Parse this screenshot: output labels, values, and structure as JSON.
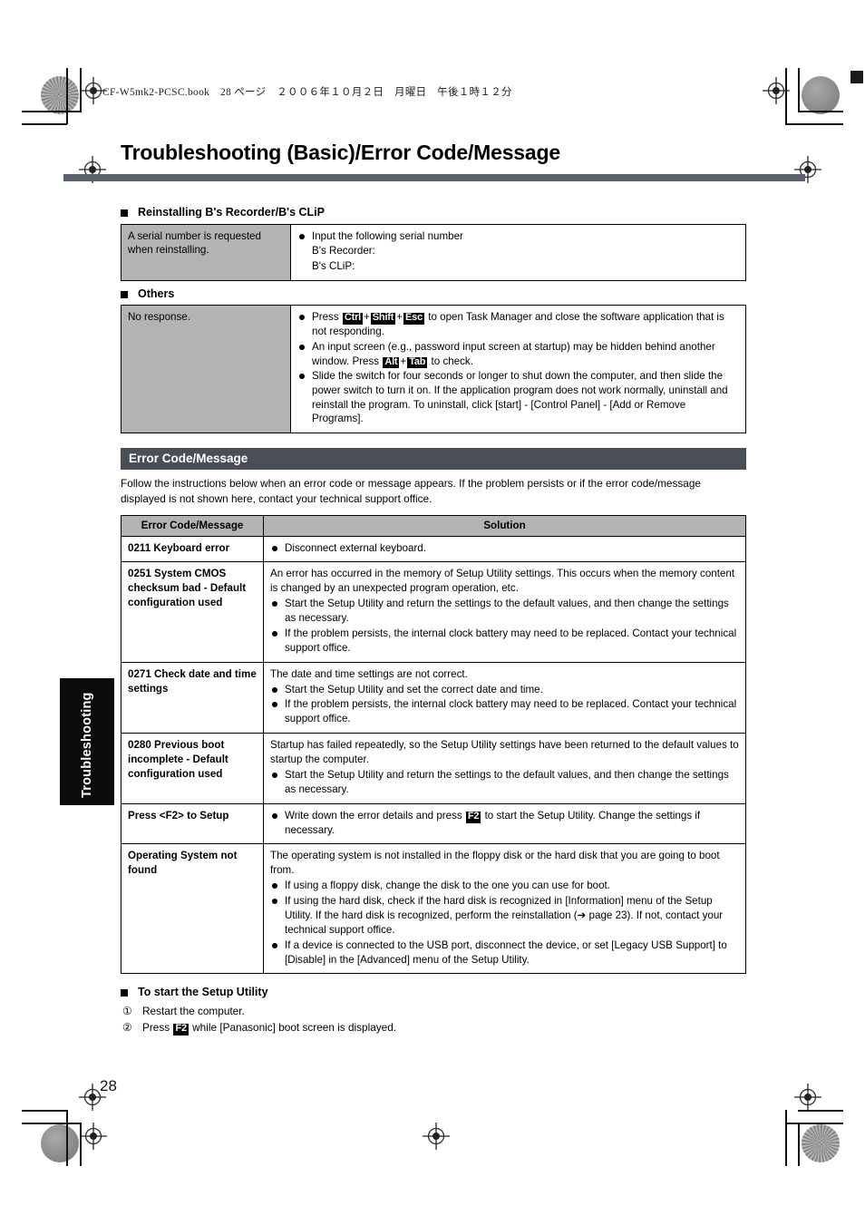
{
  "book_header": "CF-W5mk2-PCSC.book　28 ページ　２００６年１０月２日　月曜日　午後１時１２分",
  "page_title": "Troubleshooting (Basic)/Error Code/Message",
  "side_tab": "Troubleshooting",
  "folio": "28",
  "sections": {
    "reinstall": {
      "heading": "Reinstalling B's Recorder/B's CLiP",
      "row": {
        "key": "A serial number is requested when reinstalling.",
        "bullets": [
          "Input the following serial number"
        ],
        "plain_lines": [
          "B's Recorder:",
          "B's CLiP:"
        ]
      }
    },
    "others": {
      "heading": "Others",
      "row": {
        "key": "No response.",
        "bullets": [
          "Press {Ctrl}+{Shift}+{Esc} to open Task Manager and close the software application that is not responding.",
          "An input screen (e.g., password input screen at startup) may be hidden behind another window. Press {Alt}+{Tab} to check.",
          "Slide the switch for four seconds or longer to shut down the computer, and then slide the power switch to turn it on. If the application program does not work normally, uninstall and reinstall the program. To uninstall, click [start] - [Control Panel] - [Add or Remove Programs]."
        ]
      }
    }
  },
  "error_section": {
    "bar_title": "Error Code/Message",
    "intro": "Follow the instructions below when an error code or message appears. If the problem persists or if the error code/message displayed is not shown here, contact your technical support office.",
    "columns": [
      "Error Code/Message",
      "Solution"
    ],
    "rows": [
      {
        "code": "0211 Keyboard error",
        "lead": "",
        "bullets": [
          "Disconnect external keyboard."
        ]
      },
      {
        "code": "0251 System CMOS checksum bad - Default configuration used",
        "lead": "An error has occurred in the memory of Setup Utility settings. This occurs when the memory content is changed by an unexpected program operation, etc.",
        "bullets": [
          "Start the Setup Utility and return the settings to the default values, and then change the settings as necessary.",
          "If the problem persists, the internal clock battery may need to be replaced. Contact your technical support office."
        ]
      },
      {
        "code": "0271 Check date and time settings",
        "lead": "The date and time settings are not correct.",
        "bullets": [
          "Start the Setup Utility and set the correct date and time.",
          "If the problem persists, the internal clock battery may need to be replaced. Contact your technical support office."
        ]
      },
      {
        "code": "0280 Previous boot incomplete - Default configuration used",
        "lead": "Startup has failed repeatedly, so the Setup Utility settings have been returned to the default values to startup the computer.",
        "bullets": [
          "Start the Setup Utility and return the settings to the default values, and then change the settings as necessary."
        ]
      },
      {
        "code": "Press <F2> to Setup",
        "lead": "",
        "bullets": [
          "Write down the error details and press {F2} to start the Setup Utility. Change the settings if necessary."
        ]
      },
      {
        "code": "Operating System not found",
        "lead": "The operating system is not installed in the floppy disk or the hard disk that you are going to boot from.",
        "bullets": [
          "If using a floppy disk, change the disk to the one you can use for boot.",
          "If using the hard disk, check if the hard disk is recognized in [Information] menu of the Setup Utility. If the hard disk is recognized, perform the reinstallation (➔ page 23). If not, contact your technical support office.",
          "If a device is connected to the USB port, disconnect the device, or set [Legacy USB Support] to [Disable] in the [Advanced] menu of the Setup Utility."
        ]
      }
    ]
  },
  "setup_utility": {
    "heading": "To start the Setup Utility",
    "steps": [
      {
        "num": "①",
        "text": "Restart the computer."
      },
      {
        "num": "②",
        "text": "Press {F2} while [Panasonic] boot screen is displayed."
      }
    ]
  },
  "colors": {
    "rule": "#5c626b",
    "bar": "#4a4f57",
    "cell_gray": "#b3b3b3",
    "tab_black": "#0b0b0b"
  }
}
